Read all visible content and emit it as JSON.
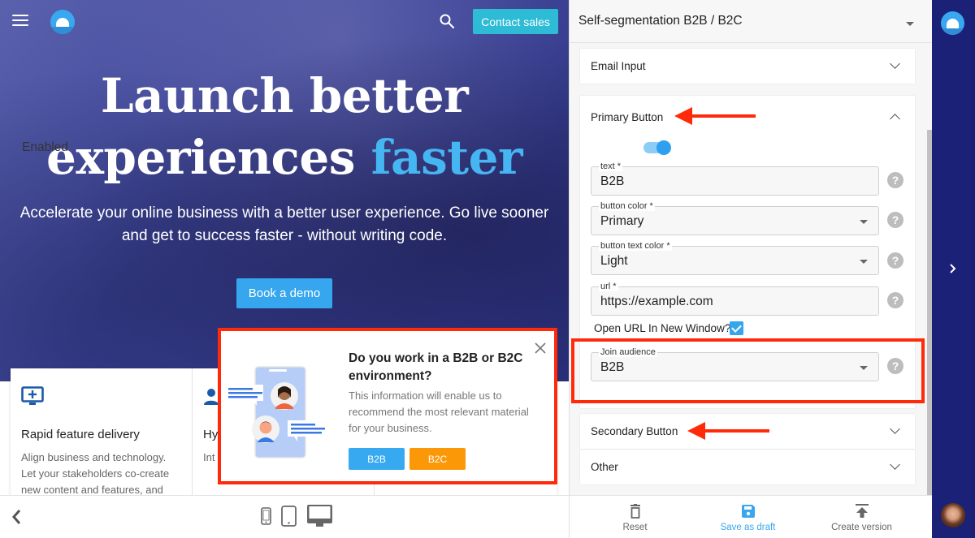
{
  "preview": {
    "topbar": {
      "menu_icon": "hamburger-menu-icon",
      "logo_icon": "brand-logo-icon",
      "search_icon": "search-icon",
      "contact_label": "Contact sales"
    },
    "hero": {
      "title_line1": "Launch better",
      "title_line2_prefix": "experiences ",
      "title_line2_accent": "faster",
      "subtitle": "Accelerate your online business with a better user experience. Go live sooner and get to success faster - without writing code.",
      "cta_label": "Book a demo",
      "accent_color": "#46b6f2"
    },
    "features": [
      {
        "icon": "monitor-plus-icon",
        "title": "Rapid feature delivery",
        "text": "Align business and technology. Let your stakeholders co-create new content and features, and"
      },
      {
        "icon": "user-icon",
        "title": "Hy",
        "text": "Int fro sys"
      },
      {
        "icon": "",
        "title": "",
        "text": ""
      }
    ],
    "popup": {
      "title": "Do you work in a B2B or B2C environment?",
      "text": "This information will enable us to recommend the most relevant material for your business.",
      "b2b_label": "B2B",
      "b2c_label": "B2C",
      "close_icon": "close-icon"
    },
    "bottom_bar": {
      "back_icon": "chevron-left-icon",
      "devices": [
        "mobile",
        "tablet",
        "desktop"
      ],
      "selected_device": "desktop"
    }
  },
  "panel": {
    "title": "Self-segmentation B2B / B2C",
    "sections": {
      "email_input": "Email Input",
      "primary_button": "Primary Button",
      "secondary_button": "Secondary Button",
      "other": "Other"
    },
    "primary": {
      "enabled_label": "Enabled",
      "enabled": true,
      "fields": [
        {
          "label": "text *",
          "value": "B2B",
          "type": "text"
        },
        {
          "label": "button color *",
          "value": "Primary",
          "type": "select"
        },
        {
          "label": "button text color *",
          "value": "Light",
          "type": "select"
        },
        {
          "label": "url *",
          "value": "https://example.com",
          "type": "text"
        }
      ],
      "open_new_window_label": "Open URL In New Window?",
      "open_new_window": true,
      "join_audience": {
        "label": "Join audience",
        "value": "B2B"
      }
    },
    "help_glyph": "?",
    "footer": {
      "reset_label": "Reset",
      "save_label": "Save as draft",
      "create_label": "Create version"
    }
  },
  "rail": {
    "logo_icon": "brand-logo-icon",
    "expand_icon": "chevron-right-icon",
    "avatar": "user-avatar"
  },
  "annotation_color": "#ff2a0a"
}
